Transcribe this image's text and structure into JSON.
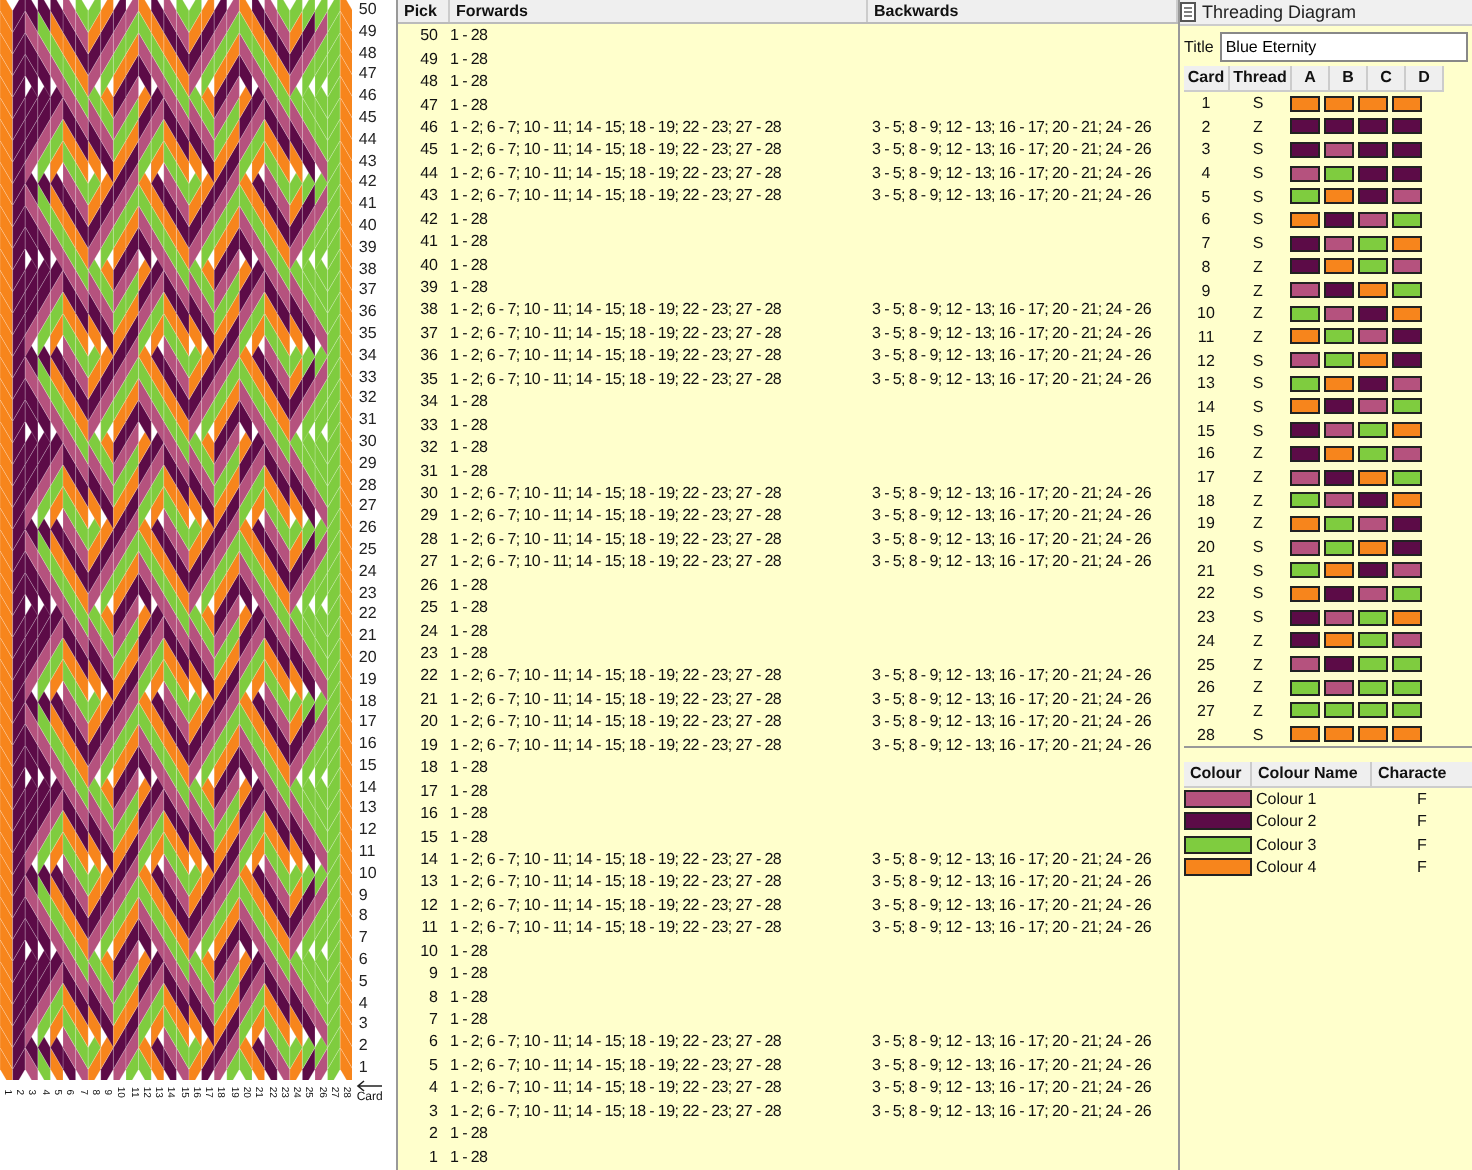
{
  "pattern": {
    "row_numbers": [
      "50",
      "49",
      "48",
      "47",
      "46",
      "45",
      "44",
      "43",
      "42",
      "41",
      "40",
      "39",
      "38",
      "37",
      "36",
      "35",
      "34",
      "33",
      "32",
      "31",
      "30",
      "29",
      "28",
      "27",
      "26",
      "25",
      "24",
      "23",
      "22",
      "21",
      "20",
      "19",
      "18",
      "17",
      "16",
      "15",
      "14",
      "13",
      "12",
      "11",
      "10",
      "9",
      "8",
      "7",
      "6",
      "5",
      "4",
      "3",
      "2",
      "1"
    ],
    "card_numbers": [
      "1",
      "2",
      "3",
      "4",
      "5",
      "6",
      "7",
      "8",
      "9",
      "10",
      "11",
      "12",
      "13",
      "14",
      "15",
      "16",
      "17",
      "18",
      "19",
      "20",
      "21",
      "22",
      "23",
      "24",
      "25",
      "26",
      "27",
      "28"
    ],
    "card_axis_label": "Card"
  },
  "picks": {
    "columns": [
      "Pick",
      "Forwards",
      "Backwards"
    ],
    "rows": [
      {
        "pick": "50",
        "forwards": "1 - 28"
      },
      {
        "pick": "49",
        "forwards": "1 - 28"
      },
      {
        "pick": "48",
        "forwards": "1 - 28"
      },
      {
        "pick": "47",
        "forwards": "1 - 28"
      },
      {
        "pick": "46",
        "forwards": "1 - 2; 6 - 7; 10 - 11; 14 - 15; 18 - 19; 22 - 23; 27 - 28",
        "backwards": "3 - 5; 8 - 9; 12 - 13; 16 - 17; 20 - 21; 24 - 26"
      },
      {
        "pick": "45",
        "forwards": "1 - 2; 6 - 7; 10 - 11; 14 - 15; 18 - 19; 22 - 23; 27 - 28",
        "backwards": "3 - 5; 8 - 9; 12 - 13; 16 - 17; 20 - 21; 24 - 26"
      },
      {
        "pick": "44",
        "forwards": "1 - 2; 6 - 7; 10 - 11; 14 - 15; 18 - 19; 22 - 23; 27 - 28",
        "backwards": "3 - 5; 8 - 9; 12 - 13; 16 - 17; 20 - 21; 24 - 26"
      },
      {
        "pick": "43",
        "forwards": "1 - 2; 6 - 7; 10 - 11; 14 - 15; 18 - 19; 22 - 23; 27 - 28",
        "backwards": "3 - 5; 8 - 9; 12 - 13; 16 - 17; 20 - 21; 24 - 26"
      },
      {
        "pick": "42",
        "forwards": "1 - 28"
      },
      {
        "pick": "41",
        "forwards": "1 - 28"
      },
      {
        "pick": "40",
        "forwards": "1 - 28"
      },
      {
        "pick": "39",
        "forwards": "1 - 28"
      },
      {
        "pick": "38",
        "forwards": "1 - 2; 6 - 7; 10 - 11; 14 - 15; 18 - 19; 22 - 23; 27 - 28",
        "backwards": "3 - 5; 8 - 9; 12 - 13; 16 - 17; 20 - 21; 24 - 26"
      },
      {
        "pick": "37",
        "forwards": "1 - 2; 6 - 7; 10 - 11; 14 - 15; 18 - 19; 22 - 23; 27 - 28",
        "backwards": "3 - 5; 8 - 9; 12 - 13; 16 - 17; 20 - 21; 24 - 26"
      },
      {
        "pick": "36",
        "forwards": "1 - 2; 6 - 7; 10 - 11; 14 - 15; 18 - 19; 22 - 23; 27 - 28",
        "backwards": "3 - 5; 8 - 9; 12 - 13; 16 - 17; 20 - 21; 24 - 26"
      },
      {
        "pick": "35",
        "forwards": "1 - 2; 6 - 7; 10 - 11; 14 - 15; 18 - 19; 22 - 23; 27 - 28",
        "backwards": "3 - 5; 8 - 9; 12 - 13; 16 - 17; 20 - 21; 24 - 26"
      },
      {
        "pick": "34",
        "forwards": "1 - 28"
      },
      {
        "pick": "33",
        "forwards": "1 - 28"
      },
      {
        "pick": "32",
        "forwards": "1 - 28"
      },
      {
        "pick": "31",
        "forwards": "1 - 28"
      },
      {
        "pick": "30",
        "forwards": "1 - 2; 6 - 7; 10 - 11; 14 - 15; 18 - 19; 22 - 23; 27 - 28",
        "backwards": "3 - 5; 8 - 9; 12 - 13; 16 - 17; 20 - 21; 24 - 26"
      },
      {
        "pick": "29",
        "forwards": "1 - 2; 6 - 7; 10 - 11; 14 - 15; 18 - 19; 22 - 23; 27 - 28",
        "backwards": "3 - 5; 8 - 9; 12 - 13; 16 - 17; 20 - 21; 24 - 26"
      },
      {
        "pick": "28",
        "forwards": "1 - 2; 6 - 7; 10 - 11; 14 - 15; 18 - 19; 22 - 23; 27 - 28",
        "backwards": "3 - 5; 8 - 9; 12 - 13; 16 - 17; 20 - 21; 24 - 26"
      },
      {
        "pick": "27",
        "forwards": "1 - 2; 6 - 7; 10 - 11; 14 - 15; 18 - 19; 22 - 23; 27 - 28",
        "backwards": "3 - 5; 8 - 9; 12 - 13; 16 - 17; 20 - 21; 24 - 26"
      },
      {
        "pick": "26",
        "forwards": "1 - 28"
      },
      {
        "pick": "25",
        "forwards": "1 - 28"
      },
      {
        "pick": "24",
        "forwards": "1 - 28"
      },
      {
        "pick": "23",
        "forwards": "1 - 28"
      },
      {
        "pick": "22",
        "forwards": "1 - 2; 6 - 7; 10 - 11; 14 - 15; 18 - 19; 22 - 23; 27 - 28",
        "backwards": "3 - 5; 8 - 9; 12 - 13; 16 - 17; 20 - 21; 24 - 26"
      },
      {
        "pick": "21",
        "forwards": "1 - 2; 6 - 7; 10 - 11; 14 - 15; 18 - 19; 22 - 23; 27 - 28",
        "backwards": "3 - 5; 8 - 9; 12 - 13; 16 - 17; 20 - 21; 24 - 26"
      },
      {
        "pick": "20",
        "forwards": "1 - 2; 6 - 7; 10 - 11; 14 - 15; 18 - 19; 22 - 23; 27 - 28",
        "backwards": "3 - 5; 8 - 9; 12 - 13; 16 - 17; 20 - 21; 24 - 26"
      },
      {
        "pick": "19",
        "forwards": "1 - 2; 6 - 7; 10 - 11; 14 - 15; 18 - 19; 22 - 23; 27 - 28",
        "backwards": "3 - 5; 8 - 9; 12 - 13; 16 - 17; 20 - 21; 24 - 26"
      },
      {
        "pick": "18",
        "forwards": "1 - 28"
      },
      {
        "pick": "17",
        "forwards": "1 - 28"
      },
      {
        "pick": "16",
        "forwards": "1 - 28"
      },
      {
        "pick": "15",
        "forwards": "1 - 28"
      },
      {
        "pick": "14",
        "forwards": "1 - 2; 6 - 7; 10 - 11; 14 - 15; 18 - 19; 22 - 23; 27 - 28",
        "backwards": "3 - 5; 8 - 9; 12 - 13; 16 - 17; 20 - 21; 24 - 26"
      },
      {
        "pick": "13",
        "forwards": "1 - 2; 6 - 7; 10 - 11; 14 - 15; 18 - 19; 22 - 23; 27 - 28",
        "backwards": "3 - 5; 8 - 9; 12 - 13; 16 - 17; 20 - 21; 24 - 26"
      },
      {
        "pick": "12",
        "forwards": "1 - 2; 6 - 7; 10 - 11; 14 - 15; 18 - 19; 22 - 23; 27 - 28",
        "backwards": "3 - 5; 8 - 9; 12 - 13; 16 - 17; 20 - 21; 24 - 26"
      },
      {
        "pick": "11",
        "forwards": "1 - 2; 6 - 7; 10 - 11; 14 - 15; 18 - 19; 22 - 23; 27 - 28",
        "backwards": "3 - 5; 8 - 9; 12 - 13; 16 - 17; 20 - 21; 24 - 26"
      },
      {
        "pick": "10",
        "forwards": "1 - 28"
      },
      {
        "pick": "9",
        "forwards": "1 - 28"
      },
      {
        "pick": "8",
        "forwards": "1 - 28"
      },
      {
        "pick": "7",
        "forwards": "1 - 28"
      },
      {
        "pick": "6",
        "forwards": "1 - 2; 6 - 7; 10 - 11; 14 - 15; 18 - 19; 22 - 23; 27 - 28",
        "backwards": "3 - 5; 8 - 9; 12 - 13; 16 - 17; 20 - 21; 24 - 26"
      },
      {
        "pick": "5",
        "forwards": "1 - 2; 6 - 7; 10 - 11; 14 - 15; 18 - 19; 22 - 23; 27 - 28",
        "backwards": "3 - 5; 8 - 9; 12 - 13; 16 - 17; 20 - 21; 24 - 26"
      },
      {
        "pick": "4",
        "forwards": "1 - 2; 6 - 7; 10 - 11; 14 - 15; 18 - 19; 22 - 23; 27 - 28",
        "backwards": "3 - 5; 8 - 9; 12 - 13; 16 - 17; 20 - 21; 24 - 26"
      },
      {
        "pick": "3",
        "forwards": "1 - 2; 6 - 7; 10 - 11; 14 - 15; 18 - 19; 22 - 23; 27 - 28",
        "backwards": "3 - 5; 8 - 9; 12 - 13; 16 - 17; 20 - 21; 24 - 26"
      },
      {
        "pick": "2",
        "forwards": "1 - 28"
      },
      {
        "pick": "1",
        "forwards": "1 - 28"
      }
    ]
  },
  "threading": {
    "title": "Threading Diagram",
    "title_label": "Title",
    "title_value": "Blue Eternity",
    "columns": [
      "Card",
      "Thread",
      "A",
      "B",
      "C",
      "D"
    ],
    "cards": [
      {
        "card": "1",
        "thread": "S",
        "holes": [
          {
            "color": "#f7851c"
          },
          {
            "color": "#f7851c"
          },
          {
            "color": "#f7851c"
          },
          {
            "color": "#f7851c"
          }
        ]
      },
      {
        "card": "2",
        "thread": "Z",
        "holes": [
          {
            "color": "#5c0b47"
          },
          {
            "color": "#5c0b47"
          },
          {
            "color": "#5c0b47"
          },
          {
            "color": "#5c0b47"
          }
        ]
      },
      {
        "card": "3",
        "thread": "S",
        "holes": [
          {
            "color": "#5c0b47"
          },
          {
            "color": "#b5527e"
          },
          {
            "color": "#5c0b47"
          },
          {
            "color": "#5c0b47"
          }
        ]
      },
      {
        "card": "4",
        "thread": "S",
        "holes": [
          {
            "color": "#b5527e"
          },
          {
            "color": "#7fcc3f"
          },
          {
            "color": "#5c0b47"
          },
          {
            "color": "#5c0b47"
          }
        ]
      },
      {
        "card": "5",
        "thread": "S",
        "holes": [
          {
            "color": "#7fcc3f"
          },
          {
            "color": "#f7851c"
          },
          {
            "color": "#5c0b47"
          },
          {
            "color": "#b5527e"
          }
        ]
      },
      {
        "card": "6",
        "thread": "S",
        "holes": [
          {
            "color": "#f7851c"
          },
          {
            "color": "#5c0b47"
          },
          {
            "color": "#b5527e"
          },
          {
            "color": "#7fcc3f"
          }
        ]
      },
      {
        "card": "7",
        "thread": "S",
        "holes": [
          {
            "color": "#5c0b47"
          },
          {
            "color": "#b5527e"
          },
          {
            "color": "#7fcc3f"
          },
          {
            "color": "#f7851c"
          }
        ]
      },
      {
        "card": "8",
        "thread": "Z",
        "holes": [
          {
            "color": "#5c0b47"
          },
          {
            "color": "#f7851c"
          },
          {
            "color": "#7fcc3f"
          },
          {
            "color": "#b5527e"
          }
        ]
      },
      {
        "card": "9",
        "thread": "Z",
        "holes": [
          {
            "color": "#b5527e"
          },
          {
            "color": "#5c0b47"
          },
          {
            "color": "#f7851c"
          },
          {
            "color": "#7fcc3f"
          }
        ]
      },
      {
        "card": "10",
        "thread": "Z",
        "holes": [
          {
            "color": "#7fcc3f"
          },
          {
            "color": "#b5527e"
          },
          {
            "color": "#5c0b47"
          },
          {
            "color": "#f7851c"
          }
        ]
      },
      {
        "card": "11",
        "thread": "Z",
        "holes": [
          {
            "color": "#f7851c"
          },
          {
            "color": "#7fcc3f"
          },
          {
            "color": "#b5527e"
          },
          {
            "color": "#5c0b47"
          }
        ]
      },
      {
        "card": "12",
        "thread": "S",
        "holes": [
          {
            "color": "#b5527e"
          },
          {
            "color": "#7fcc3f"
          },
          {
            "color": "#f7851c"
          },
          {
            "color": "#5c0b47"
          }
        ]
      },
      {
        "card": "13",
        "thread": "S",
        "holes": [
          {
            "color": "#7fcc3f"
          },
          {
            "color": "#f7851c"
          },
          {
            "color": "#5c0b47"
          },
          {
            "color": "#b5527e"
          }
        ]
      },
      {
        "card": "14",
        "thread": "S",
        "holes": [
          {
            "color": "#f7851c"
          },
          {
            "color": "#5c0b47"
          },
          {
            "color": "#b5527e"
          },
          {
            "color": "#7fcc3f"
          }
        ]
      },
      {
        "card": "15",
        "thread": "S",
        "holes": [
          {
            "color": "#5c0b47"
          },
          {
            "color": "#b5527e"
          },
          {
            "color": "#7fcc3f"
          },
          {
            "color": "#f7851c"
          }
        ]
      },
      {
        "card": "16",
        "thread": "Z",
        "holes": [
          {
            "color": "#5c0b47"
          },
          {
            "color": "#f7851c"
          },
          {
            "color": "#7fcc3f"
          },
          {
            "color": "#b5527e"
          }
        ]
      },
      {
        "card": "17",
        "thread": "Z",
        "holes": [
          {
            "color": "#b5527e"
          },
          {
            "color": "#5c0b47"
          },
          {
            "color": "#f7851c"
          },
          {
            "color": "#7fcc3f"
          }
        ]
      },
      {
        "card": "18",
        "thread": "Z",
        "holes": [
          {
            "color": "#7fcc3f"
          },
          {
            "color": "#b5527e"
          },
          {
            "color": "#5c0b47"
          },
          {
            "color": "#f7851c"
          }
        ]
      },
      {
        "card": "19",
        "thread": "Z",
        "holes": [
          {
            "color": "#f7851c"
          },
          {
            "color": "#7fcc3f"
          },
          {
            "color": "#b5527e"
          },
          {
            "color": "#5c0b47"
          }
        ]
      },
      {
        "card": "20",
        "thread": "S",
        "holes": [
          {
            "color": "#b5527e"
          },
          {
            "color": "#7fcc3f"
          },
          {
            "color": "#f7851c"
          },
          {
            "color": "#5c0b47"
          }
        ]
      },
      {
        "card": "21",
        "thread": "S",
        "holes": [
          {
            "color": "#7fcc3f"
          },
          {
            "color": "#f7851c"
          },
          {
            "color": "#5c0b47"
          },
          {
            "color": "#b5527e"
          }
        ]
      },
      {
        "card": "22",
        "thread": "S",
        "holes": [
          {
            "color": "#f7851c"
          },
          {
            "color": "#5c0b47"
          },
          {
            "color": "#b5527e"
          },
          {
            "color": "#7fcc3f"
          }
        ]
      },
      {
        "card": "23",
        "thread": "S",
        "holes": [
          {
            "color": "#5c0b47"
          },
          {
            "color": "#b5527e"
          },
          {
            "color": "#7fcc3f"
          },
          {
            "color": "#f7851c"
          }
        ]
      },
      {
        "card": "24",
        "thread": "Z",
        "holes": [
          {
            "color": "#5c0b47"
          },
          {
            "color": "#f7851c"
          },
          {
            "color": "#7fcc3f"
          },
          {
            "color": "#b5527e"
          }
        ]
      },
      {
        "card": "25",
        "thread": "Z",
        "holes": [
          {
            "color": "#b5527e"
          },
          {
            "color": "#5c0b47"
          },
          {
            "color": "#7fcc3f"
          },
          {
            "color": "#7fcc3f"
          }
        ]
      },
      {
        "card": "26",
        "thread": "Z",
        "holes": [
          {
            "color": "#7fcc3f"
          },
          {
            "color": "#b5527e"
          },
          {
            "color": "#7fcc3f"
          },
          {
            "color": "#7fcc3f"
          }
        ]
      },
      {
        "card": "27",
        "thread": "Z",
        "holes": [
          {
            "color": "#7fcc3f"
          },
          {
            "color": "#7fcc3f"
          },
          {
            "color": "#7fcc3f"
          },
          {
            "color": "#7fcc3f"
          }
        ]
      },
      {
        "card": "28",
        "thread": "S",
        "holes": [
          {
            "color": "#f7851c"
          },
          {
            "color": "#f7851c"
          },
          {
            "color": "#f7851c"
          },
          {
            "color": "#f7851c"
          }
        ]
      }
    ]
  },
  "colours": {
    "columns": [
      "Colour",
      "Colour Name",
      "Characte"
    ],
    "rows": [
      {
        "color": "#b5527e",
        "name": "Colour 1",
        "character": "F"
      },
      {
        "color": "#5c0b47",
        "name": "Colour 2",
        "character": "F"
      },
      {
        "color": "#7fcc3f",
        "name": "Colour 3",
        "character": "F"
      },
      {
        "color": "#f7851c",
        "name": "Colour 4",
        "character": "F"
      }
    ]
  }
}
